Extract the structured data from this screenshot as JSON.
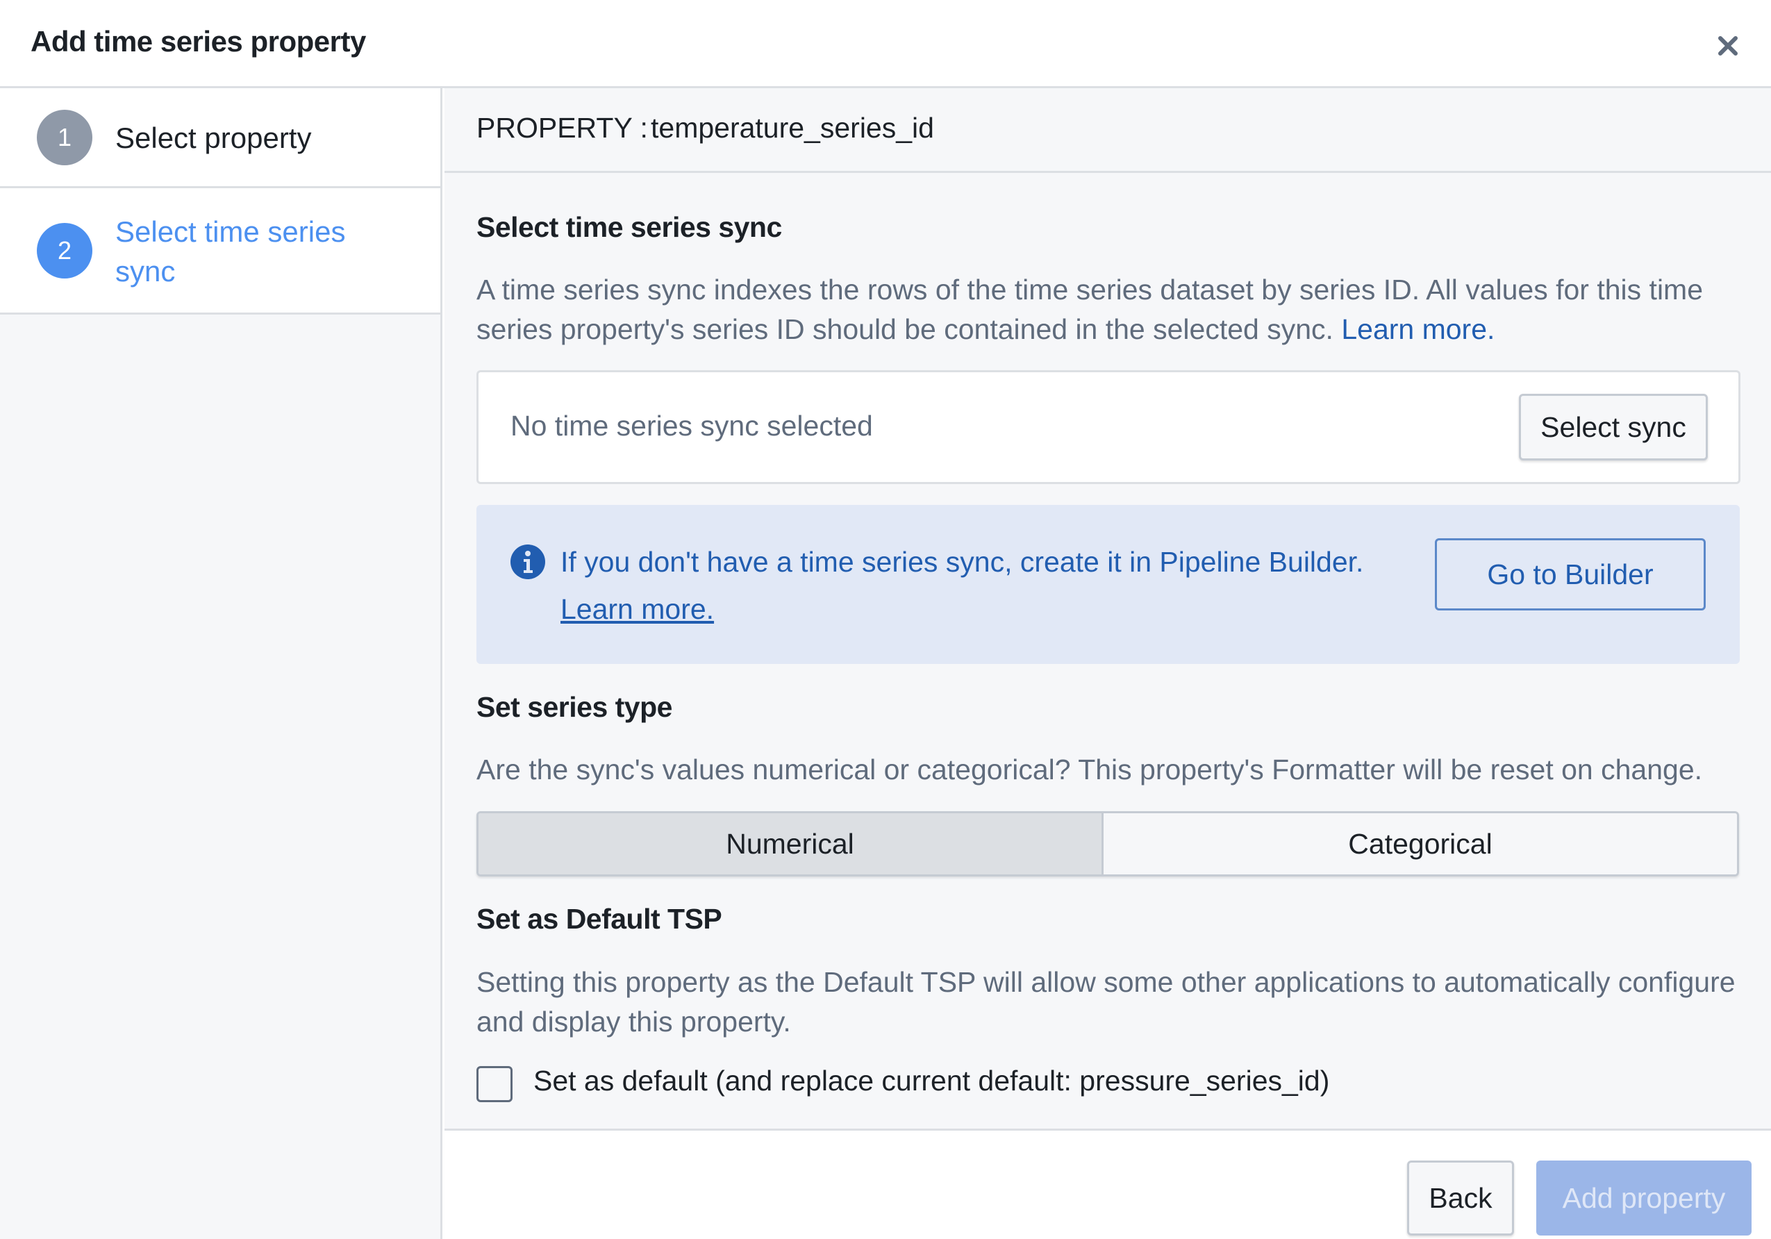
{
  "dialog": {
    "title": "Add time series property",
    "close_icon": "close-icon"
  },
  "steps": [
    {
      "number": "1",
      "label": "Select property",
      "state": "complete"
    },
    {
      "number": "2",
      "label": "Select time series sync",
      "state": "active"
    }
  ],
  "property": {
    "label": "PROPERTY :",
    "value": "temperature_series_id"
  },
  "sync_section": {
    "title": "Select time series sync",
    "description": "A time series sync indexes the rows of the time series dataset by series ID. All values for this time series property's series ID should be contained in the selected sync.",
    "learn_more": "Learn more.",
    "empty_text": "No time series sync selected",
    "select_button": "Select sync"
  },
  "callout": {
    "icon": "info-icon",
    "text": "If you don't have a time series sync, create it in Pipeline Builder.",
    "learn_more": "Learn more.",
    "button": "Go to Builder"
  },
  "series_type": {
    "title": "Set series type",
    "description": "Are the sync's values numerical or categorical? This property's Formatter will be reset on change.",
    "options": [
      {
        "label": "Numerical",
        "selected": true
      },
      {
        "label": "Categorical",
        "selected": false
      }
    ]
  },
  "default_tsp": {
    "title": "Set as Default TSP",
    "description": "Setting this property as the Default TSP will allow some other applications to automatically configure and display this property.",
    "checkbox_label": "Set as default (and replace current default: pressure_series_id)",
    "checked": false
  },
  "footer": {
    "back_button": "Back",
    "submit_button": "Add property",
    "submit_disabled": true
  },
  "colors": {
    "accent": "#4c90f0",
    "link": "#215db0",
    "callout_bg": "#e1e8f6",
    "disabled_primary": "#9bb6e8",
    "step_complete": "#8f99a8"
  }
}
